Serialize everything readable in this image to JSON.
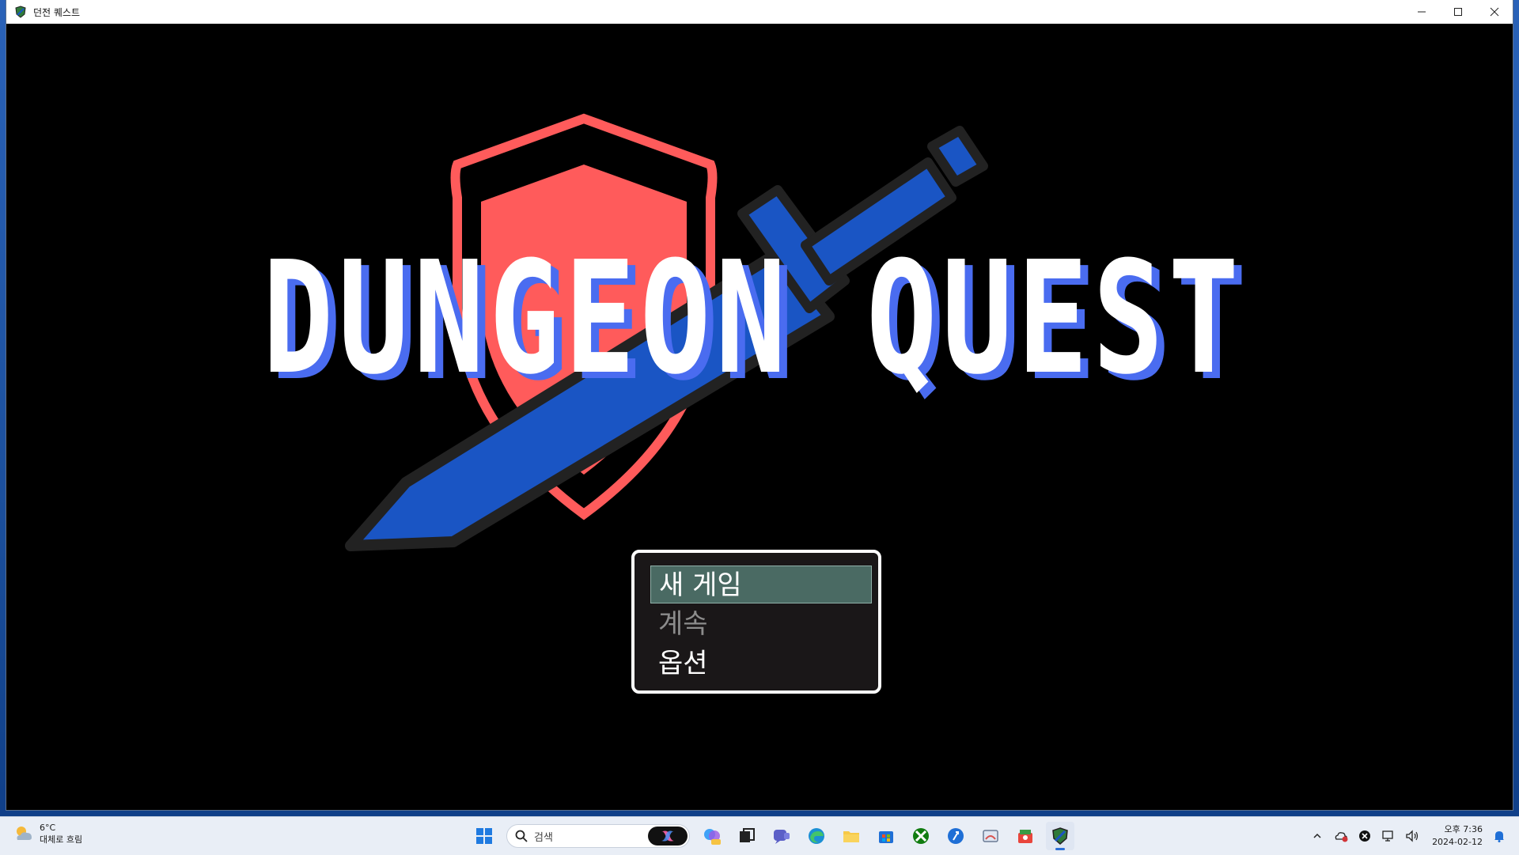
{
  "window": {
    "title": "던전 퀘스트"
  },
  "logo": {
    "text": "DUNGEON QUEST"
  },
  "menu": {
    "items": [
      {
        "label": "새 게임",
        "state": "selected"
      },
      {
        "label": "계속",
        "state": "disabled"
      },
      {
        "label": "옵션",
        "state": "normal"
      }
    ]
  },
  "taskbar": {
    "weather": {
      "temperature": "6°C",
      "condition": "대체로 흐림"
    },
    "search": {
      "placeholder": "검색"
    },
    "clock": {
      "time": "오후 7:36",
      "date": "2024-02-12"
    }
  },
  "colors": {
    "shield": "#ff5b5b",
    "sword": "#1a55c4",
    "title_text": "#ffffff",
    "title_shadow": "#4a6cf0",
    "menu_highlight": "#4a6a63"
  }
}
